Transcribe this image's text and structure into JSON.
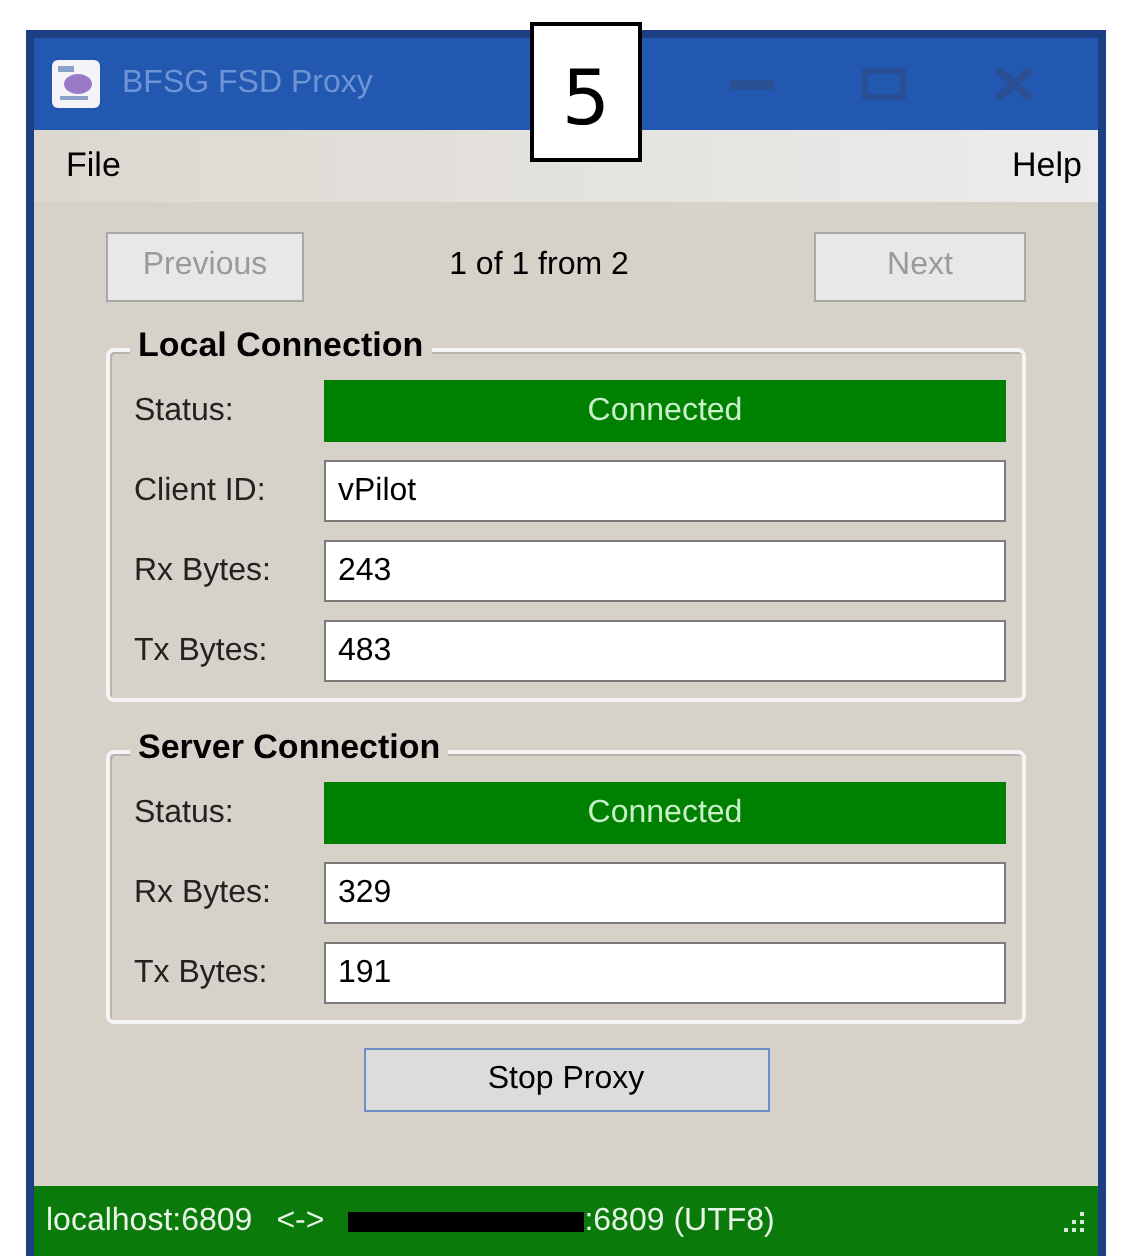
{
  "annotation": {
    "label": "5"
  },
  "window": {
    "title": "BFSG FSD Proxy"
  },
  "menu": [
    {
      "label": "File"
    },
    {
      "label": "Help"
    }
  ],
  "navigation": {
    "previous": {
      "label": "Previous",
      "disabled": true
    },
    "position": "1 of 1 from 2",
    "next": {
      "label": "Next",
      "disabled": true
    }
  },
  "groups": [
    {
      "title": "Local Connection",
      "fields": [
        {
          "kind": "status",
          "label": "Status:",
          "value": "Connected",
          "color": "#008000"
        },
        {
          "kind": "text",
          "label": "Client ID:",
          "value": "vPilot"
        },
        {
          "kind": "text",
          "label": "Rx Bytes:",
          "value": "243"
        },
        {
          "kind": "text",
          "label": "Tx Bytes:",
          "value": "483"
        }
      ]
    },
    {
      "title": "Server Connection",
      "fields": [
        {
          "kind": "status",
          "label": "Status:",
          "value": "Connected",
          "color": "#008000"
        },
        {
          "kind": "text",
          "label": "Rx Bytes:",
          "value": "329"
        },
        {
          "kind": "text",
          "label": "Tx Bytes:",
          "value": "191"
        }
      ]
    }
  ],
  "action": {
    "label": "Stop Proxy"
  },
  "status_bar": {
    "parts": [
      {
        "kind": "text",
        "text": "localhost:6809"
      },
      {
        "kind": "text",
        "text": "<->"
      },
      {
        "kind": "redacted"
      },
      {
        "kind": "text",
        "text": ":6809 (UTF8)"
      }
    ]
  }
}
